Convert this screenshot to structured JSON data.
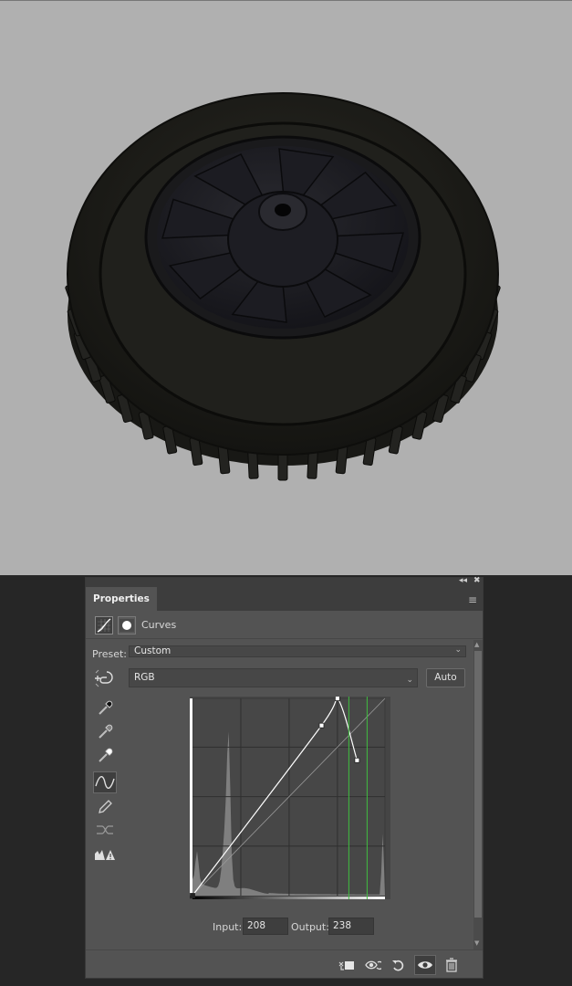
{
  "panel": {
    "tab_title": "Properties",
    "collapse_glyph": "◂◂",
    "close_glyph": "✖",
    "menu_glyph": "≡",
    "adjustment_label": "Curves"
  },
  "preset": {
    "label": "Preset:",
    "value": "Custom"
  },
  "channel": {
    "value": "RGB",
    "auto_label": "Auto"
  },
  "tools": [
    {
      "name": "black-point-eyedropper-icon"
    },
    {
      "name": "gray-point-eyedropper-icon"
    },
    {
      "name": "white-point-eyedropper-icon"
    },
    {
      "name": "edit-points-curve-icon",
      "active": true
    },
    {
      "name": "pencil-draw-icon"
    },
    {
      "name": "smooth-curve-icon"
    },
    {
      "name": "clipping-warning-icon"
    }
  ],
  "curves": {
    "input_label": "Input:",
    "input_value": "208",
    "output_label": "Output:",
    "output_value": "238",
    "points": [
      [
        0,
        0
      ],
      [
        171,
        220
      ],
      [
        192,
        255
      ],
      [
        218,
        175
      ]
    ],
    "selected_point": [
      208,
      238
    ]
  },
  "footer_icons": [
    "clip-to-layer-icon",
    "view-previous-state-icon",
    "reset-adjustment-icon",
    "visibility-eye-icon",
    "delete-trash-icon"
  ],
  "colors": {
    "canvas_bg": "#b0b0b0",
    "panel_bg": "#535353",
    "selection_highlight": "#3fbf3f"
  }
}
